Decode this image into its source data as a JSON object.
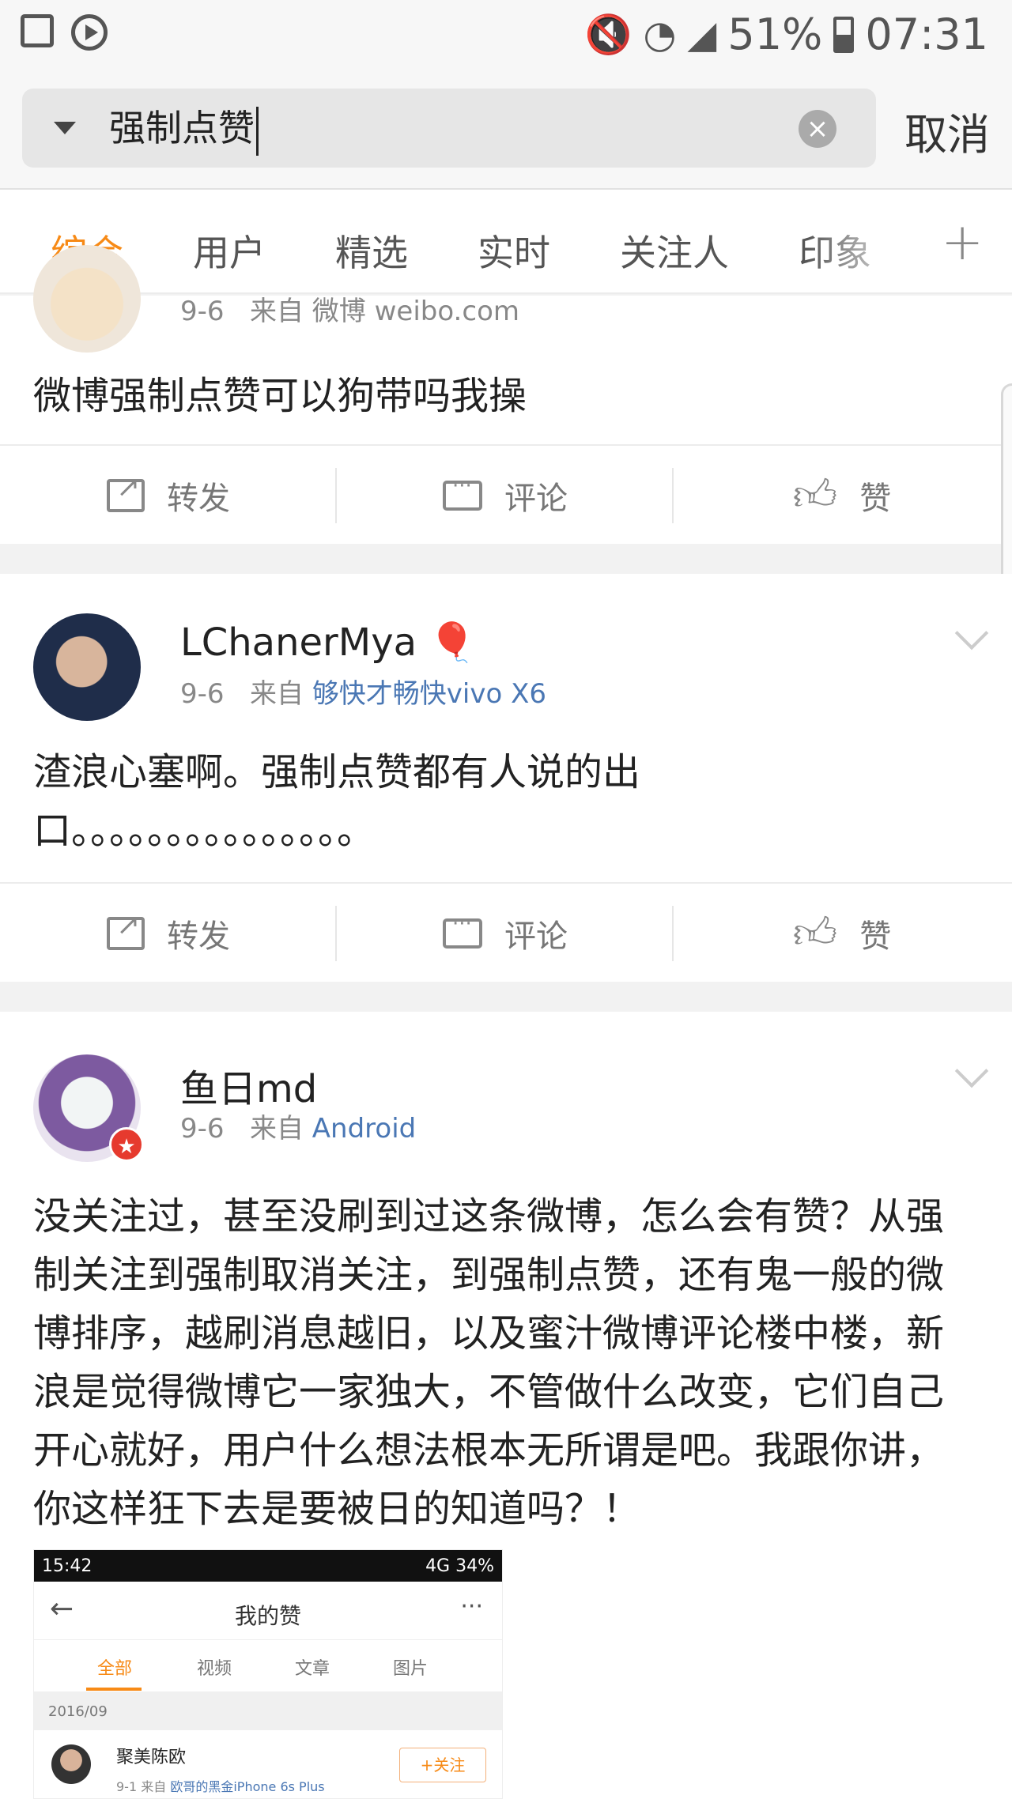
{
  "status_bar": {
    "battery": "51%",
    "time": "07:31"
  },
  "search": {
    "query": "强制点赞",
    "cancel": "取消"
  },
  "tabs": [
    "综合",
    "用户",
    "精选",
    "实时",
    "关注人",
    "印象"
  ],
  "actions": {
    "repost": "转发",
    "comment": "评论",
    "like": "赞"
  },
  "posts": [
    {
      "date": "9-6",
      "from_prefix": "来自",
      "source": "微博 weibo.com",
      "text": "微博强制点赞可以狗带吗我操"
    },
    {
      "username": "LChanerMya",
      "date": "9-6",
      "from_prefix": "来自",
      "source": "够快才畅快vivo X6",
      "text": "渣浪心塞啊。强制点赞都有人说的出口。。。。。。。。。。。。。。。"
    },
    {
      "username": "鱼日md",
      "date": "9-6",
      "from_prefix": "来自",
      "source": "Android",
      "text": "没关注过，甚至没刷到过这条微博，怎么会有赞？从强制关注到强制取消关注，到强制点赞，还有鬼一般的微博排序，越刷消息越旧，以及蜜汁微博评论楼中楼，新浪是觉得微博它一家独大，不管做什么改变，它们自己开心就好，用户什么想法根本无所谓是吧。我跟你讲，你这样狂下去是要被日的知道吗？！"
    }
  ],
  "embedded_screenshot": {
    "time": "15:42",
    "status": "4G 34%",
    "title": "我的赞",
    "tabs": [
      "全部",
      "视频",
      "文章",
      "图片"
    ],
    "date": "2016/09",
    "user": "聚美陈欧",
    "meta_date": "9-1",
    "meta_from": "来自",
    "meta_source": "欧哥的黑金iPhone 6s Plus",
    "follow": "+关注"
  }
}
